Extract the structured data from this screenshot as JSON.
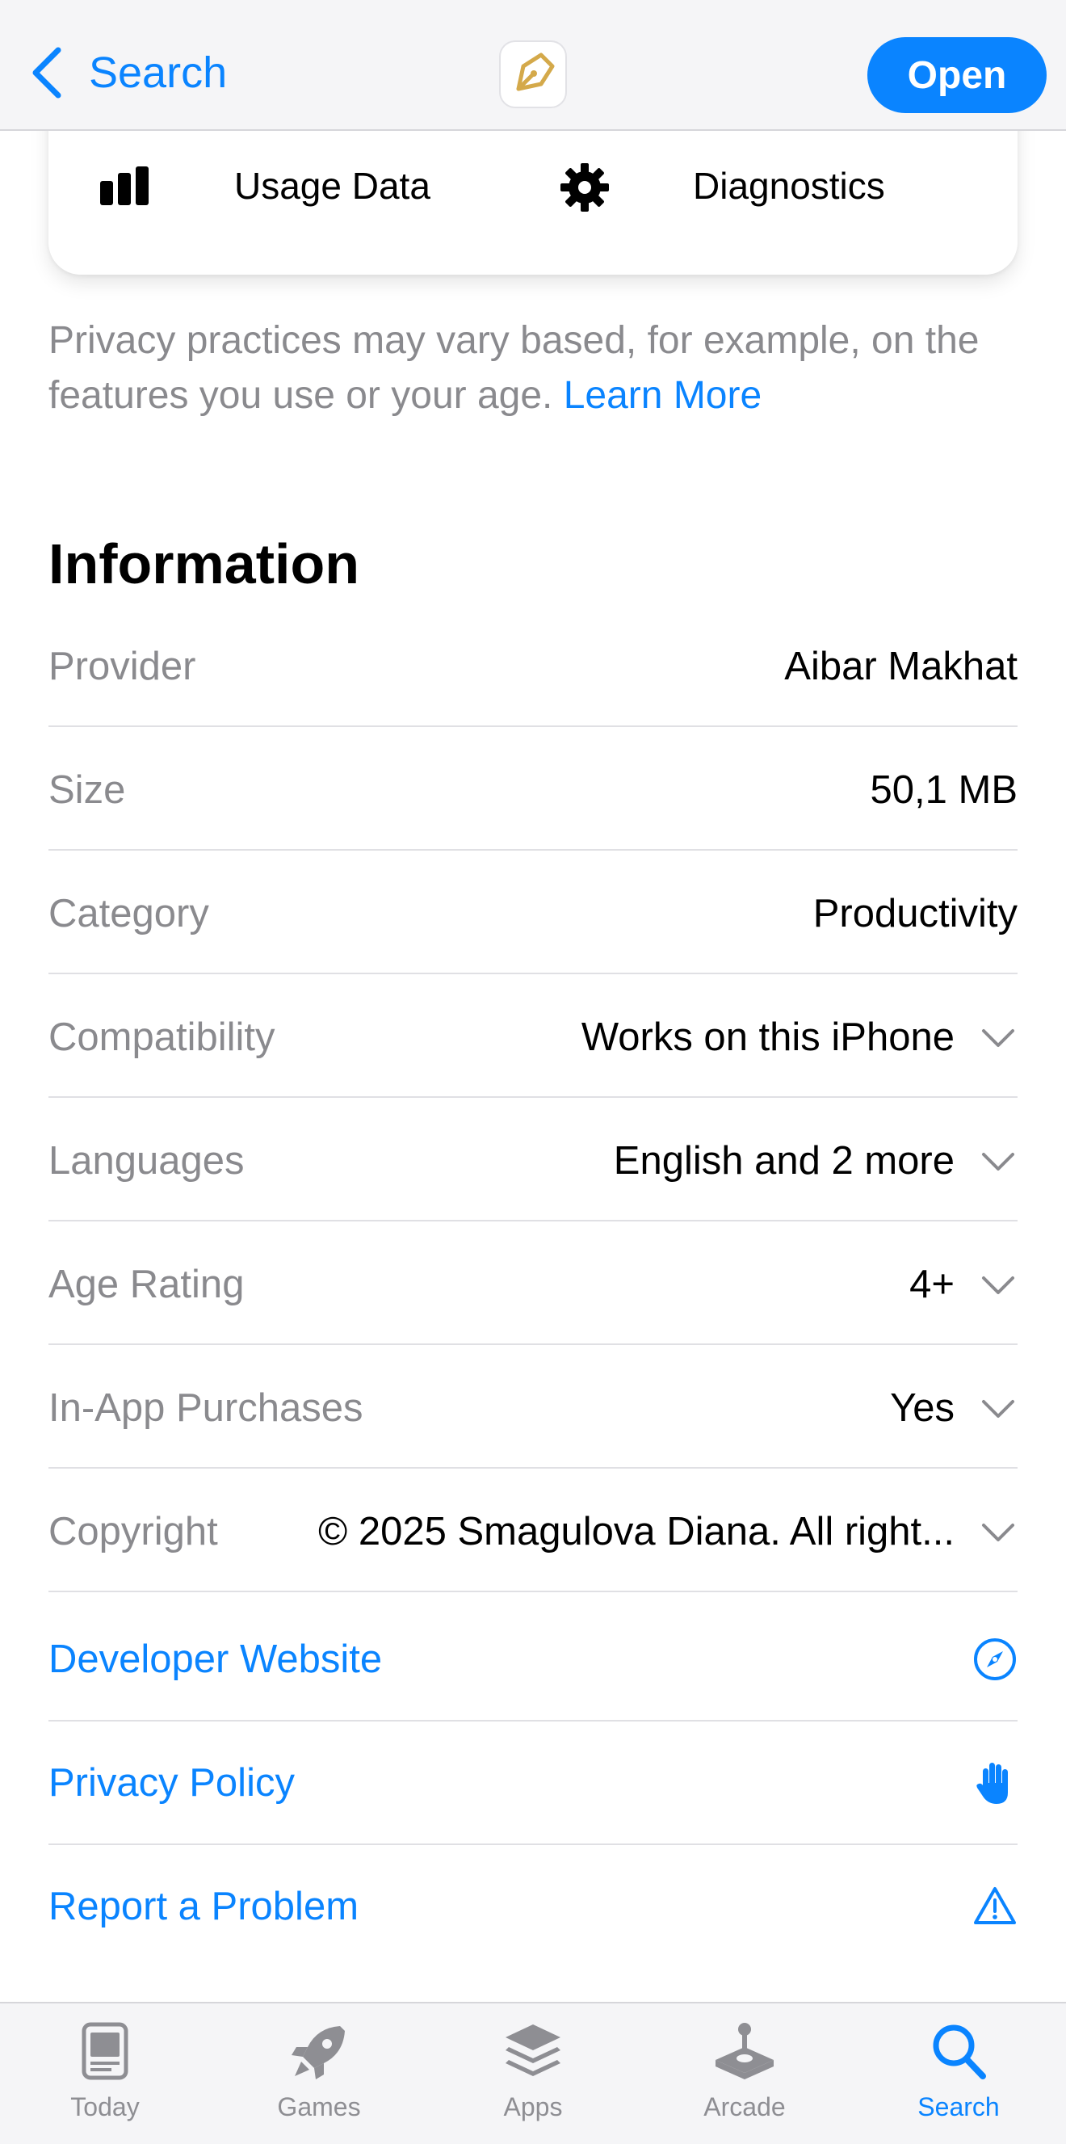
{
  "nav": {
    "back_label": "Search",
    "open_label": "Open"
  },
  "privacy_card": {
    "items": [
      {
        "icon": "bar-chart-icon",
        "label": "Usage Data"
      },
      {
        "icon": "gear-icon",
        "label": "Diagnostics"
      }
    ]
  },
  "privacy_note": {
    "text": "Privacy practices may vary based, for example, on the features you use or your age. ",
    "link": "Learn More"
  },
  "information": {
    "title": "Information",
    "rows": [
      {
        "key": "Provider",
        "value": "Aibar Makhat"
      },
      {
        "key": "Size",
        "value": "50,1 MB"
      },
      {
        "key": "Category",
        "value": "Productivity"
      },
      {
        "key": "Compatibility",
        "value": "Works on this iPhone"
      },
      {
        "key": "Languages",
        "value": "English and 2 more"
      },
      {
        "key": "Age Rating",
        "value": "4+"
      },
      {
        "key": "In-App Purchases",
        "value": "Yes"
      },
      {
        "key": "Copyright",
        "value": "© 2025 Smagulova Diana. All right..."
      }
    ],
    "links": [
      {
        "label": "Developer Website",
        "icon": "compass-icon"
      },
      {
        "label": "Privacy Policy",
        "icon": "hand-icon"
      },
      {
        "label": "Report a Problem",
        "icon": "warning-icon"
      }
    ]
  },
  "tabbar": {
    "tabs": [
      {
        "label": "Today",
        "icon": "today-icon"
      },
      {
        "label": "Games",
        "icon": "rocket-icon"
      },
      {
        "label": "Apps",
        "icon": "apps-stack-icon"
      },
      {
        "label": "Arcade",
        "icon": "joystick-icon"
      },
      {
        "label": "Search",
        "icon": "search-icon"
      }
    ],
    "active": "Search"
  },
  "colors": {
    "accent": "#0a84ff",
    "secondary_text": "#8a8a8e",
    "app_icon_gold": "#d4a94a"
  }
}
